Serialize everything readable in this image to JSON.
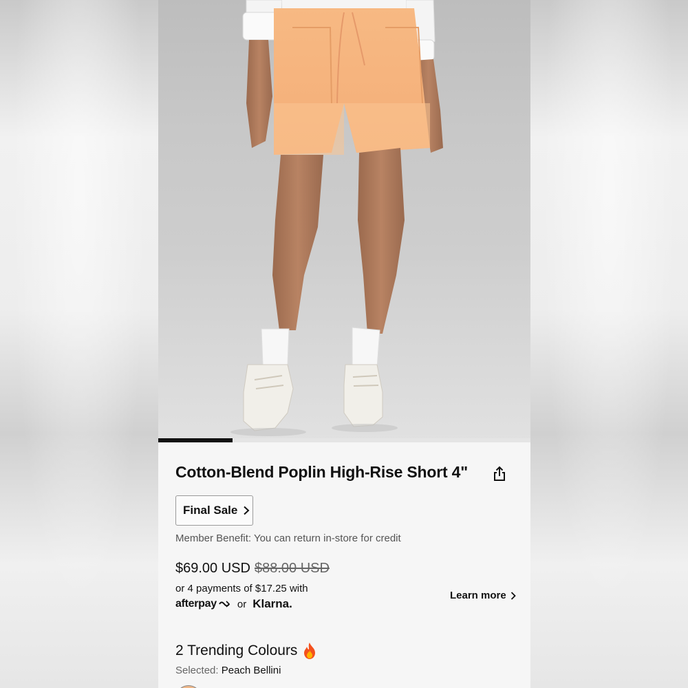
{
  "product": {
    "title": "Cotton-Blend Poplin High-Rise Short 4\"",
    "final_sale_label": "Final Sale",
    "member_benefit": "Member Benefit: You can return in-store for credit",
    "price_current": "$69.00 USD",
    "price_original": "$88.00 USD",
    "payments_text": "or 4 payments of $17.25 with",
    "afterpay_label": "afterpay",
    "or_label": "or",
    "klarna_label": "Klarna.",
    "learn_more_label": "Learn more",
    "colours_heading": "2 Trending Colours",
    "selected_prefix": "Selected:",
    "selected_colour": "Peach Bellini"
  },
  "gallery": {
    "progress_fraction": 0.2
  },
  "icons": {
    "share": "share-icon",
    "chevron": "chevron-right-icon",
    "fire": "fire-icon",
    "afterpay_logo": "afterpay-arrows-icon"
  },
  "colors": {
    "shorts": "#f6b27e",
    "swatch_peach_bellini": "#f0b889",
    "text_primary": "#111111",
    "text_secondary": "#555555"
  }
}
